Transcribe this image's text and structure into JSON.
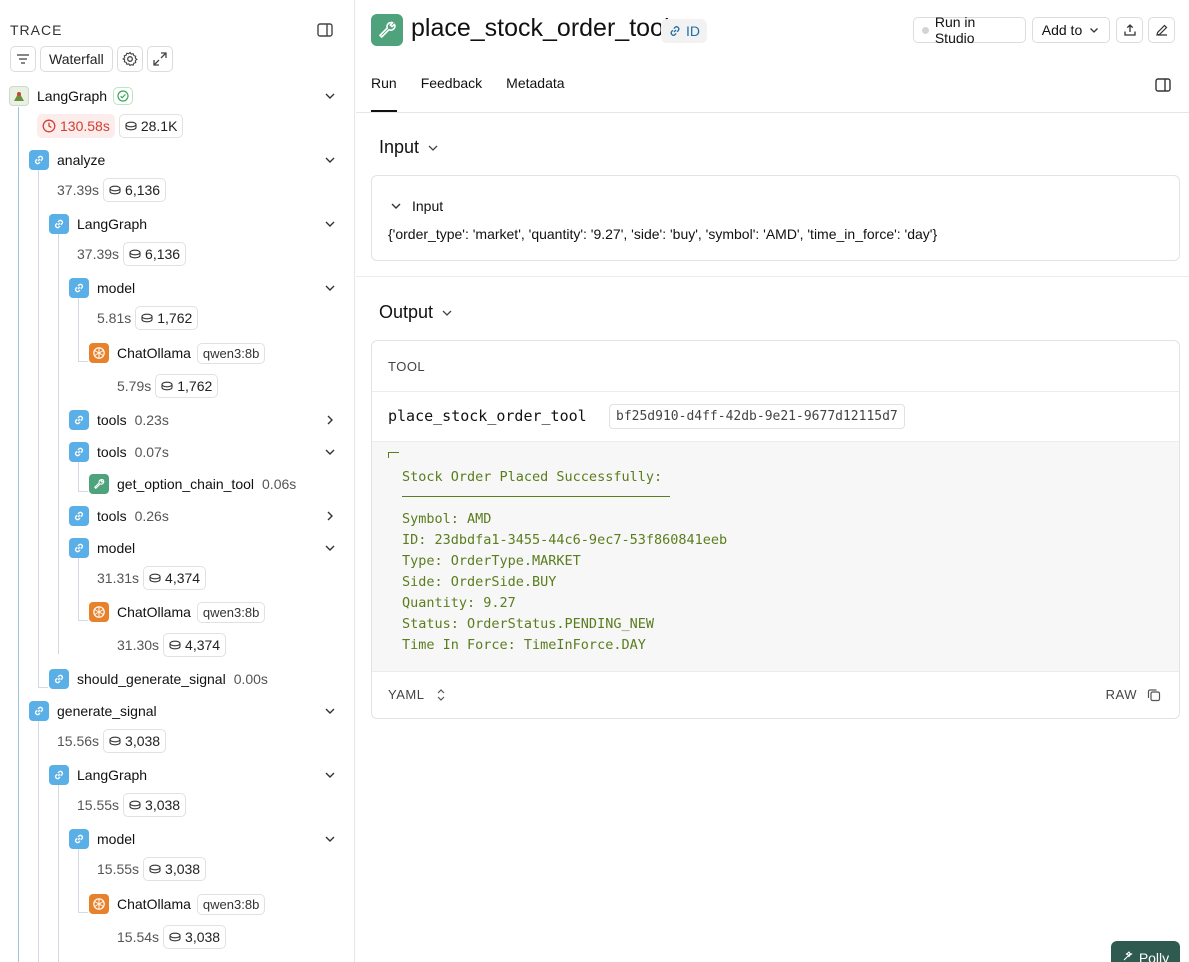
{
  "trace": {
    "title": "TRACE",
    "waterfall_label": "Waterfall",
    "root": {
      "label": "LangGraph",
      "latency": "130.58s",
      "tokens": "28.1K"
    },
    "nodes": [
      {
        "label": "analyze",
        "latency": "37.39s",
        "tokens": "6,136"
      },
      {
        "label": "LangGraph",
        "latency": "37.39s",
        "tokens": "6,136"
      },
      {
        "label": "model",
        "latency": "5.81s",
        "tokens": "1,762"
      },
      {
        "label": "ChatOllama",
        "tag": "qwen3:8b",
        "latency": "5.79s",
        "tokens": "1,762"
      },
      {
        "label": "tools",
        "latency": "0.23s"
      },
      {
        "label": "tools",
        "latency": "0.07s"
      },
      {
        "label": "get_option_chain_tool",
        "latency": "0.06s"
      },
      {
        "label": "tools",
        "latency": "0.26s"
      },
      {
        "label": "model",
        "latency": "31.31s",
        "tokens": "4,374"
      },
      {
        "label": "ChatOllama",
        "tag": "qwen3:8b",
        "latency": "31.30s",
        "tokens": "4,374"
      },
      {
        "label": "should_generate_signal",
        "latency": "0.00s"
      },
      {
        "label": "generate_signal",
        "latency": "15.56s",
        "tokens": "3,038"
      },
      {
        "label": "LangGraph",
        "latency": "15.55s",
        "tokens": "3,038"
      },
      {
        "label": "model",
        "latency": "15.55s",
        "tokens": "3,038"
      },
      {
        "label": "ChatOllama",
        "tag": "qwen3:8b",
        "latency": "15.54s",
        "tokens": "3,038"
      }
    ]
  },
  "run": {
    "title": "place_stock_order_tool",
    "id_label": "ID",
    "run_in_studio": "Run in Studio",
    "add_to": "Add to",
    "tabs": [
      "Run",
      "Feedback",
      "Metadata"
    ],
    "input": {
      "section_title": "Input",
      "card_title": "Input",
      "value": "{'order_type': 'market', 'quantity': '9.27', 'side': 'buy', 'symbol': 'AMD', 'time_in_force': 'day'}"
    },
    "output": {
      "section_title": "Output",
      "kind": "TOOL",
      "tool_name": "place_stock_order_tool",
      "tool_call_id": "bf25d910-d4ff-42db-9e21-9677d12115d7",
      "lines": [
        "Stock Order Placed Successfully:",
        "Symbol: AMD",
        "ID: 23dbdfa1-3455-44c6-9ec7-53f860841eeb",
        "Type: OrderType.MARKET",
        "Side: OrderSide.BUY",
        "Quantity: 9.27",
        "Status: OrderStatus.PENDING_NEW",
        "Time In Force: TimeInForce.DAY"
      ],
      "format_label": "YAML",
      "raw_label": "RAW"
    },
    "polly_label": "Polly"
  }
}
